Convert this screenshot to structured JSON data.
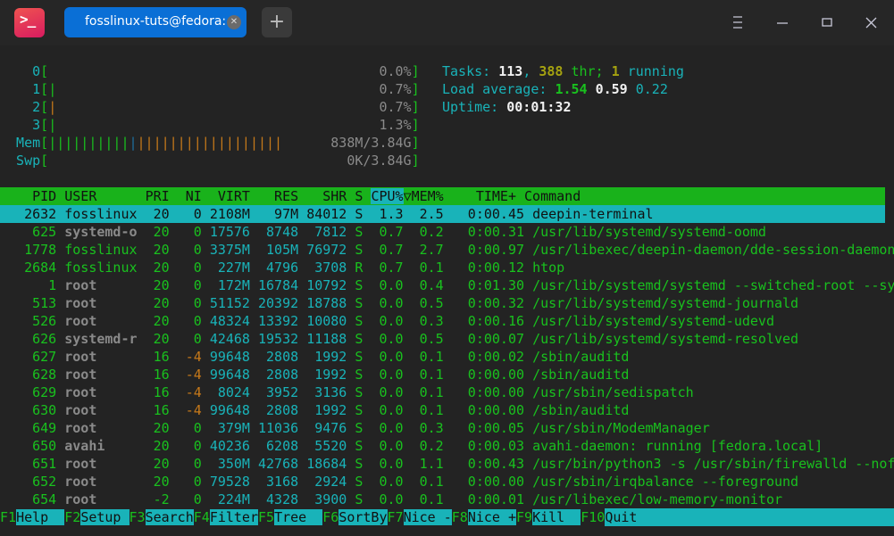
{
  "window": {
    "app_icon": "terminal-app-icon",
    "tab_title": "fosslinux-tuts@fedora:~",
    "tab_close_icon": "close-icon",
    "new_tab_icon": "plus-icon",
    "controls": [
      "menu-icon",
      "minimize-icon",
      "maximize-icon",
      "close-icon"
    ]
  },
  "meters": {
    "cpus": [
      {
        "label": "0",
        "bars": {
          "green": 0,
          "orange": 0
        },
        "value": "0.0%"
      },
      {
        "label": "1",
        "bars": {
          "green": 1,
          "orange": 0
        },
        "value": "0.7%"
      },
      {
        "label": "2",
        "bars": {
          "green": 0,
          "orange": 1
        },
        "value": "0.7%"
      },
      {
        "label": "3",
        "bars": {
          "green": 1,
          "orange": 0
        },
        "value": "1.3%"
      }
    ],
    "mem": {
      "label": "Mem",
      "bars": {
        "green": 10,
        "blue": 1,
        "orange": 18
      },
      "value": "838M/3.84G"
    },
    "swp": {
      "label": "Swp",
      "bars": {
        "green": 0
      },
      "value": "0K/3.84G"
    }
  },
  "summary": {
    "tasks_label": "Tasks: ",
    "tasks": "113",
    "sep1": ", ",
    "threads": "388",
    "thr_label": " thr; ",
    "running": "1",
    "running_label": " running",
    "load_label": "Load average: ",
    "load1": "1.54",
    "load5": "0.59",
    "load15": "0.22",
    "uptime_label": "Uptime: ",
    "uptime": "00:01:32"
  },
  "table": {
    "columns": [
      "PID",
      "USER",
      "PRI",
      "NI",
      "VIRT",
      "RES",
      "SHR",
      "S",
      "CPU%",
      "MEM%",
      "TIME+",
      "Command"
    ],
    "sort_column": "CPU%",
    "sort_indicator": "▽",
    "selected_pid": "2632",
    "rows": [
      {
        "pid": "2632",
        "user": "fosslinux",
        "pri": "20",
        "ni": "0",
        "virt": "2108M",
        "res": "97M",
        "shr": "84012",
        "s": "S",
        "cpu": "1.3",
        "mem": "2.5",
        "time": "0:00.45",
        "cmd": "deepin-terminal"
      },
      {
        "pid": "625",
        "user": "systemd-o",
        "pri": "20",
        "ni": "0",
        "virt": "17576",
        "res": "8748",
        "shr": "7812",
        "s": "S",
        "cpu": "0.7",
        "mem": "0.2",
        "time": "0:00.31",
        "cmd": "/usr/lib/systemd/systemd-oomd"
      },
      {
        "pid": "1778",
        "user": "fosslinux",
        "pri": "20",
        "ni": "0",
        "virt": "3375M",
        "res": "105M",
        "shr": "76972",
        "s": "S",
        "cpu": "0.7",
        "mem": "2.7",
        "time": "0:00.97",
        "cmd": "/usr/libexec/deepin-daemon/dde-session-daemon"
      },
      {
        "pid": "2684",
        "user": "fosslinux",
        "pri": "20",
        "ni": "0",
        "virt": "227M",
        "res": "4796",
        "shr": "3708",
        "s": "R",
        "cpu": "0.7",
        "mem": "0.1",
        "time": "0:00.12",
        "cmd": "htop"
      },
      {
        "pid": "1",
        "user": "root",
        "pri": "20",
        "ni": "0",
        "virt": "172M",
        "res": "16784",
        "shr": "10792",
        "s": "S",
        "cpu": "0.0",
        "mem": "0.4",
        "time": "0:01.30",
        "cmd": "/usr/lib/systemd/systemd --switched-root --sy"
      },
      {
        "pid": "513",
        "user": "root",
        "pri": "20",
        "ni": "0",
        "virt": "51152",
        "res": "20392",
        "shr": "18788",
        "s": "S",
        "cpu": "0.0",
        "mem": "0.5",
        "time": "0:00.32",
        "cmd": "/usr/lib/systemd/systemd-journald"
      },
      {
        "pid": "526",
        "user": "root",
        "pri": "20",
        "ni": "0",
        "virt": "48324",
        "res": "13392",
        "shr": "10080",
        "s": "S",
        "cpu": "0.0",
        "mem": "0.3",
        "time": "0:00.16",
        "cmd": "/usr/lib/systemd/systemd-udevd"
      },
      {
        "pid": "626",
        "user": "systemd-r",
        "pri": "20",
        "ni": "0",
        "virt": "42468",
        "res": "19532",
        "shr": "11188",
        "s": "S",
        "cpu": "0.0",
        "mem": "0.5",
        "time": "0:00.07",
        "cmd": "/usr/lib/systemd/systemd-resolved"
      },
      {
        "pid": "627",
        "user": "root",
        "pri": "16",
        "ni": "-4",
        "virt": "99648",
        "res": "2808",
        "shr": "1992",
        "s": "S",
        "cpu": "0.0",
        "mem": "0.1",
        "time": "0:00.02",
        "cmd": "/sbin/auditd"
      },
      {
        "pid": "628",
        "user": "root",
        "pri": "16",
        "ni": "-4",
        "virt": "99648",
        "res": "2808",
        "shr": "1992",
        "s": "S",
        "cpu": "0.0",
        "mem": "0.1",
        "time": "0:00.00",
        "cmd": "/sbin/auditd"
      },
      {
        "pid": "629",
        "user": "root",
        "pri": "16",
        "ni": "-4",
        "virt": "8024",
        "res": "3952",
        "shr": "3136",
        "s": "S",
        "cpu": "0.0",
        "mem": "0.1",
        "time": "0:00.00",
        "cmd": "/usr/sbin/sedispatch"
      },
      {
        "pid": "630",
        "user": "root",
        "pri": "16",
        "ni": "-4",
        "virt": "99648",
        "res": "2808",
        "shr": "1992",
        "s": "S",
        "cpu": "0.0",
        "mem": "0.1",
        "time": "0:00.00",
        "cmd": "/sbin/auditd"
      },
      {
        "pid": "649",
        "user": "root",
        "pri": "20",
        "ni": "0",
        "virt": "379M",
        "res": "11036",
        "shr": "9476",
        "s": "S",
        "cpu": "0.0",
        "mem": "0.3",
        "time": "0:00.05",
        "cmd": "/usr/sbin/ModemManager"
      },
      {
        "pid": "650",
        "user": "avahi",
        "pri": "20",
        "ni": "0",
        "virt": "40236",
        "res": "6208",
        "shr": "5520",
        "s": "S",
        "cpu": "0.0",
        "mem": "0.2",
        "time": "0:00.03",
        "cmd": "avahi-daemon: running [fedora.local]"
      },
      {
        "pid": "651",
        "user": "root",
        "pri": "20",
        "ni": "0",
        "virt": "350M",
        "res": "42768",
        "shr": "18684",
        "s": "S",
        "cpu": "0.0",
        "mem": "1.1",
        "time": "0:00.43",
        "cmd": "/usr/bin/python3 -s /usr/sbin/firewalld --nof"
      },
      {
        "pid": "652",
        "user": "root",
        "pri": "20",
        "ni": "0",
        "virt": "79528",
        "res": "3168",
        "shr": "2924",
        "s": "S",
        "cpu": "0.0",
        "mem": "0.1",
        "time": "0:00.00",
        "cmd": "/usr/sbin/irqbalance --foreground"
      },
      {
        "pid": "654",
        "user": "root",
        "pri": "-2",
        "ni": "0",
        "virt": "224M",
        "res": "4328",
        "shr": "3900",
        "s": "S",
        "cpu": "0.0",
        "mem": "0.1",
        "time": "0:00.01",
        "cmd": "/usr/libexec/low-memory-monitor"
      }
    ]
  },
  "footer": [
    {
      "key": "F1",
      "label": "Help  "
    },
    {
      "key": "F2",
      "label": "Setup "
    },
    {
      "key": "F3",
      "label": "Search"
    },
    {
      "key": "F4",
      "label": "Filter"
    },
    {
      "key": "F5",
      "label": "Tree  "
    },
    {
      "key": "F6",
      "label": "SortBy"
    },
    {
      "key": "F7",
      "label": "Nice -"
    },
    {
      "key": "F8",
      "label": "Nice +"
    },
    {
      "key": "F9",
      "label": "Kill  "
    },
    {
      "key": "F10",
      "label": "Quit"
    }
  ],
  "colors": {
    "accent_tab": "#0a6fd6",
    "header_bar": "#19b21b",
    "selection": "#19b3b9",
    "text_green": "#19c11e",
    "text_cyan": "#19b3b9",
    "bar_orange": "#c77a1a",
    "bar_blue": "#1e6fa0"
  }
}
